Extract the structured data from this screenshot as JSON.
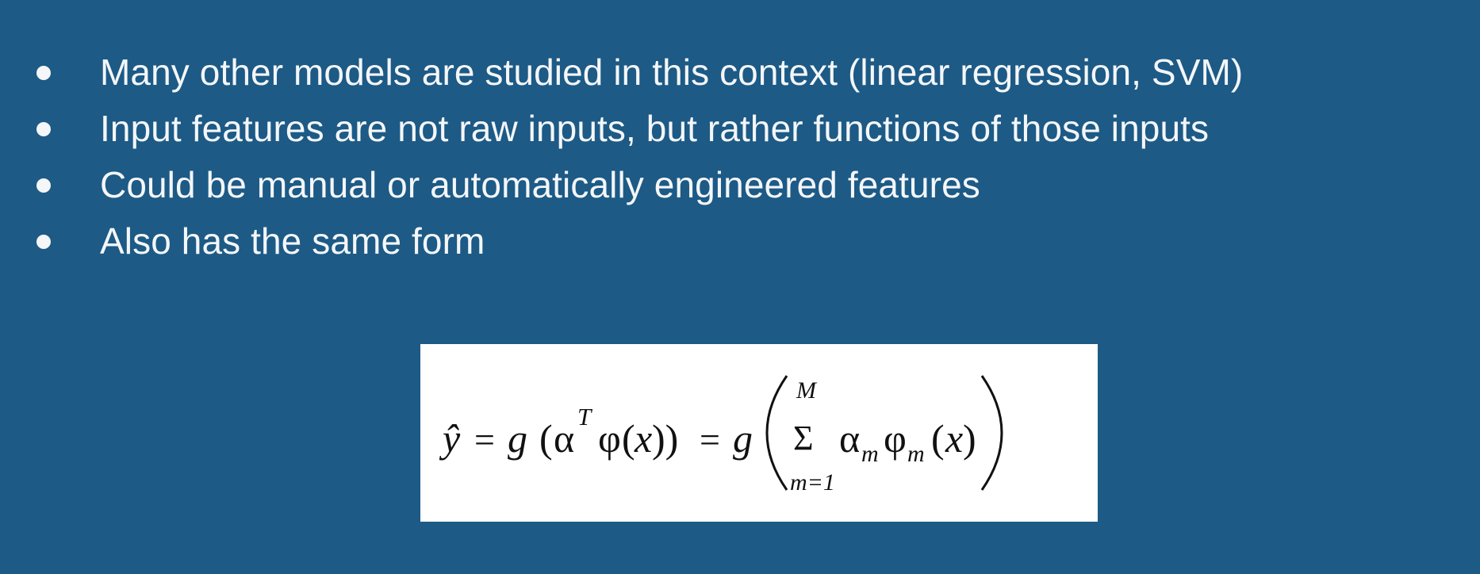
{
  "slide": {
    "bullets": [
      "Many other models are studied in this context (linear regression, SVM)",
      "Input features are not raw inputs, but rather functions of those inputs",
      "Could be manual or automatically engineered features",
      "Also has the same form"
    ],
    "formula": {
      "lhs": "ŷ",
      "eq1": "=",
      "g1": "g",
      "open_paren_1": "(",
      "alpha_1": "α",
      "sup_T": "T",
      "phi_1": "φ",
      "open_paren_2": "(",
      "x_1": "x",
      "close_parens_1": "))",
      "eq2": "=",
      "g2": "g",
      "sum_symbol": "Σ",
      "sum_upper": "M",
      "sum_lower": "m=1",
      "alpha_2": "α",
      "sub_m_1": "m",
      "phi_2": "φ",
      "sub_m_2": "m",
      "open_paren_3": "(",
      "x_2": "x",
      "close_paren_3": ")"
    }
  }
}
